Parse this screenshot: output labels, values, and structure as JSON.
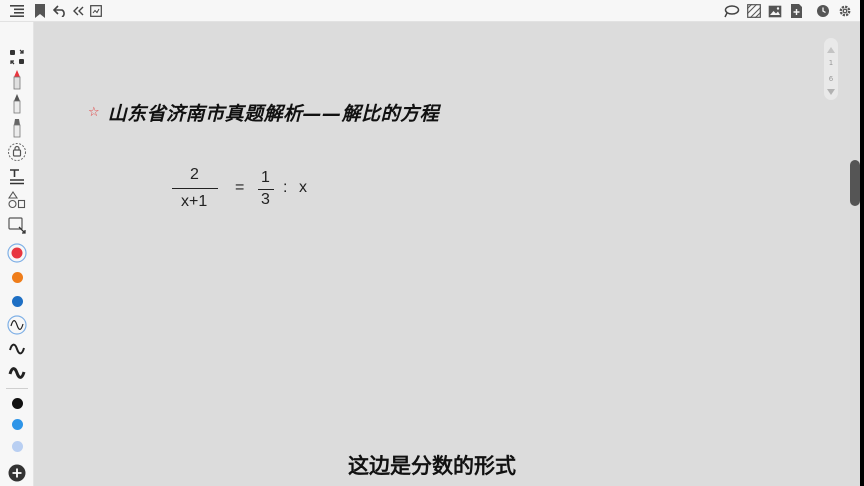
{
  "toolbar": {
    "icons": [
      "outline-icon",
      "bookmark-icon",
      "undo-icon",
      "collapse-icon",
      "image-icon",
      "lasso-icon",
      "pattern-icon",
      "insert-image-icon",
      "add-page-icon",
      "history-icon",
      "settings-icon"
    ]
  },
  "sidebar": {
    "tools": [
      "select-tool-icon",
      "pen-tool-icon",
      "highlighter-tool-icon",
      "marker-tool-icon",
      "lasso-tool-icon",
      "text-tool-icon",
      "shape-tool-icon",
      "image-tool-icon"
    ],
    "colors": {
      "red": "#e8363f",
      "orange": "#ef7d1a",
      "blue": "#1e6fc4",
      "black": "#111111",
      "sky": "#2e95e8",
      "light": "#b9cff2"
    },
    "strokes": [
      "thin-stroke-icon",
      "medium-stroke-icon",
      "thick-stroke-icon"
    ],
    "add": "add-icon"
  },
  "pager": {
    "current": "1",
    "total": "6"
  },
  "content": {
    "title": "山东省济南市真题解析——解比的方程",
    "equation": {
      "lhs_num": "2",
      "lhs_den": "x+1",
      "equals": "=",
      "rhs_num": "1",
      "rhs_den": "3",
      "ratio": ":",
      "rhs_var": "x"
    }
  },
  "caption": "这边是分数的形式"
}
